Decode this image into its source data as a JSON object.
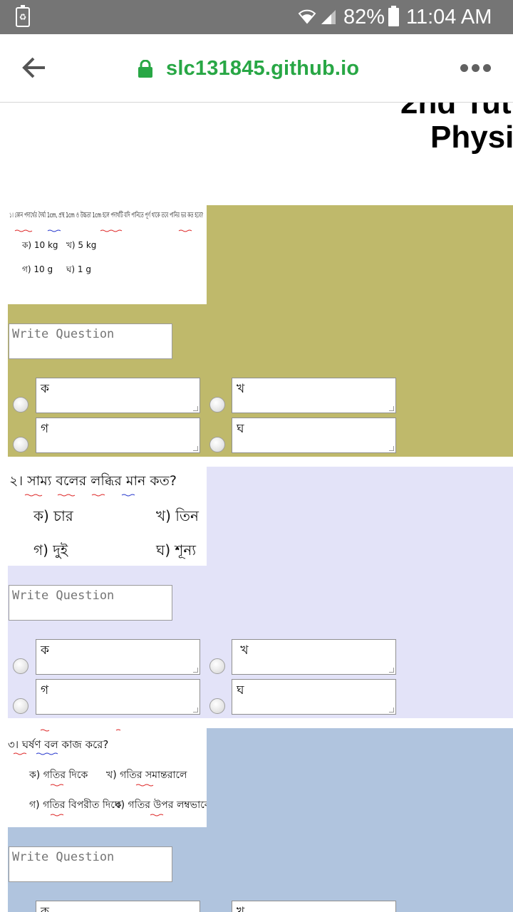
{
  "status_bar": {
    "battery_percent": "82%",
    "time": "11:04 AM"
  },
  "browser": {
    "url": "slc131845.github.io"
  },
  "page": {
    "heading_line1": "2nd Tut",
    "heading_line2": "Physic"
  },
  "questions": [
    {
      "image_text": "১। কোন পদার্থের দৈর্ঘ্য 1cm, প্রস্থ 1cm ও উচ্চতা 1cm হলে পদার্থটি যদি পানিতে পূর্ণ থাকে তবে পানির ভর কত হবে?",
      "image_options": [
        "ক) 10 kg",
        "খ) 5 kg",
        "গ) 10 g",
        "ঘ) 1 g"
      ],
      "write_placeholder": "Write Question",
      "options": [
        {
          "label": "ক"
        },
        {
          "label": "খ"
        },
        {
          "label": "গ"
        },
        {
          "label": "ঘ"
        }
      ],
      "bg_color": "#bfb96b"
    },
    {
      "image_text": "২। সাম্য বলের লব্ধির মান কত?",
      "image_options": [
        "ক) চার",
        "খ) তিন",
        "গ) দুই",
        "ঘ) শূন্য"
      ],
      "write_placeholder": "Write Question",
      "options": [
        {
          "label": "ক"
        },
        {
          "label": " খ"
        },
        {
          "label": "গ"
        },
        {
          "label": "ঘ"
        }
      ],
      "bg_color": "#e3e3f8"
    },
    {
      "image_text": "৩। ঘর্ষণ বল কাজ করে?",
      "image_options": [
        "ক) গতির দিকে",
        "খ) গতির সমান্তরালে",
        "গ) গতির বিপরীত দিকে",
        "ঘ) গতির উপর লম্বভাবে"
      ],
      "write_placeholder": "Write Question",
      "options": [
        {
          "label": "ক"
        },
        {
          "label": "খ"
        }
      ],
      "bg_color": "#b0c4de"
    }
  ]
}
